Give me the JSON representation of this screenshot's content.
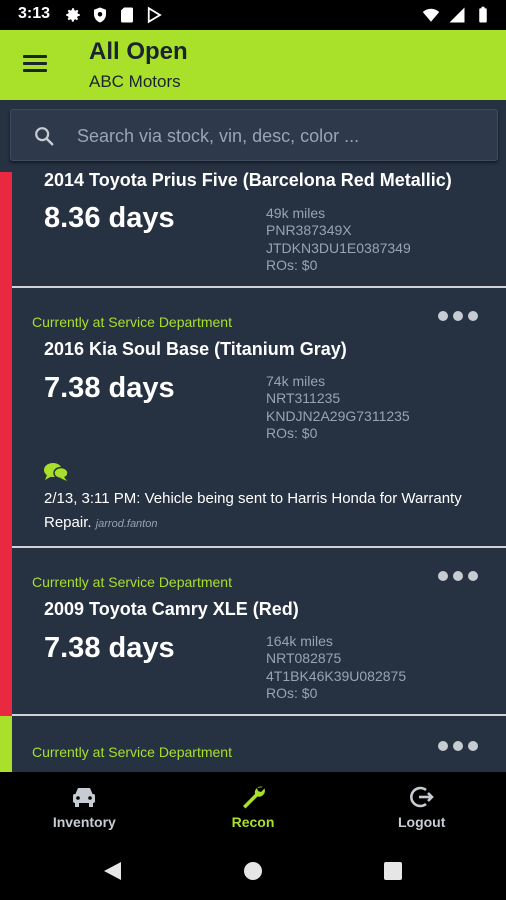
{
  "status_bar": {
    "time": "3:13",
    "left_icons": [
      "gear-icon",
      "shield-icon",
      "sd-card-icon",
      "play-store-icon"
    ],
    "right_icons": [
      "wifi-icon",
      "signal-icon",
      "battery-icon"
    ]
  },
  "app_bar": {
    "title": "All Open",
    "subtitle": "ABC Motors",
    "menu_icon": "hamburger-menu-icon"
  },
  "search": {
    "placeholder": "Search via stock, vin, desc, color ...",
    "value": ""
  },
  "colors": {
    "accent_green": "#a8e02a",
    "accent_red": "#e8293f",
    "card_bg": "#263141",
    "nav_bg": "#000000"
  },
  "vehicles": [
    {
      "status": "",
      "title": "2014 Toyota Prius Five (Barcelona Red Metallic)",
      "days": "8.36 days",
      "miles": "49k miles",
      "stock": "PNR387349X",
      "vin": "JTDKN3DU1E0387349",
      "ros": "ROs: $0",
      "accent": "#e8293f"
    },
    {
      "status": "Currently at Service Department",
      "title": "2016 Kia Soul Base (Titanium Gray)",
      "days": "7.38 days",
      "miles": "74k miles",
      "stock": "NRT311235",
      "vin": "KNDJN2A29G7311235",
      "ros": "ROs: $0",
      "accent": "#e8293f",
      "note": {
        "text": "2/13, 3:11 PM: Vehicle being sent to Harris Honda for Warranty Repair.",
        "author": "jarrod.fanton",
        "icon": "chat-bubbles-icon"
      }
    },
    {
      "status": "Currently at Service Department",
      "title": "2009 Toyota Camry XLE (Red)",
      "days": "7.38 days",
      "miles": "164k miles",
      "stock": "NRT082875",
      "vin": "4T1BK46K39U082875",
      "ros": "ROs: $0",
      "accent": "#e8293f"
    },
    {
      "status": "Currently at Service Department",
      "accent": "#a8e02a"
    }
  ],
  "bottom_nav": [
    {
      "label": "Inventory",
      "icon": "car-icon",
      "active": false
    },
    {
      "label": "Recon",
      "icon": "wrench-icon",
      "active": true
    },
    {
      "label": "Logout",
      "icon": "logout-icon",
      "active": false
    }
  ],
  "system_nav": [
    "back-icon",
    "home-icon",
    "recents-icon"
  ]
}
